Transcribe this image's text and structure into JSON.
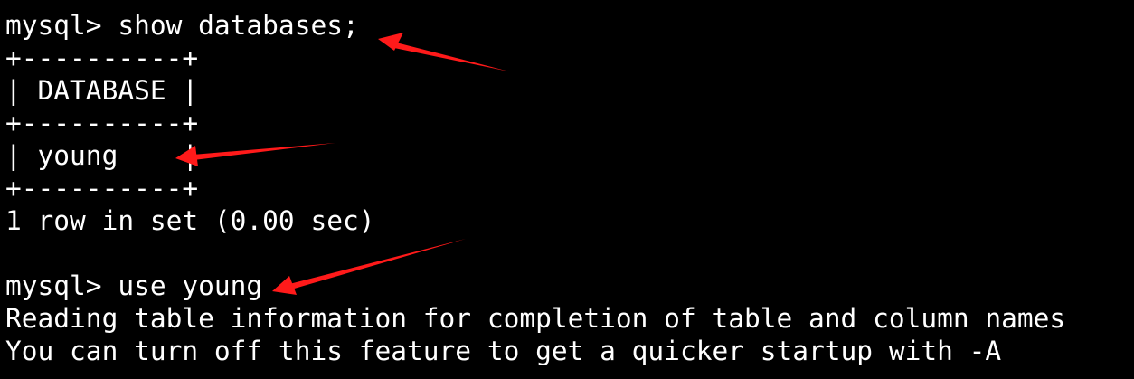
{
  "terminal": {
    "lines": [
      "mysql> show databases;",
      "+----------+",
      "| DATABASE |",
      "+----------+",
      "| young    |",
      "+----------+",
      "1 row in set (0.00 sec)",
      "",
      "mysql> use young",
      "Reading table information for completion of table and column names",
      "You can turn off this feature to get a quicker startup with -A"
    ]
  },
  "colors": {
    "background": "#000000",
    "text": "#ffffff",
    "annotation": "#ff1a1a"
  },
  "annotations": [
    {
      "name": "arrow-icon",
      "points_to": "mysql> show databases;"
    },
    {
      "name": "arrow-icon",
      "points_to": "| young    |"
    },
    {
      "name": "arrow-icon",
      "points_to": "mysql> use young"
    }
  ]
}
